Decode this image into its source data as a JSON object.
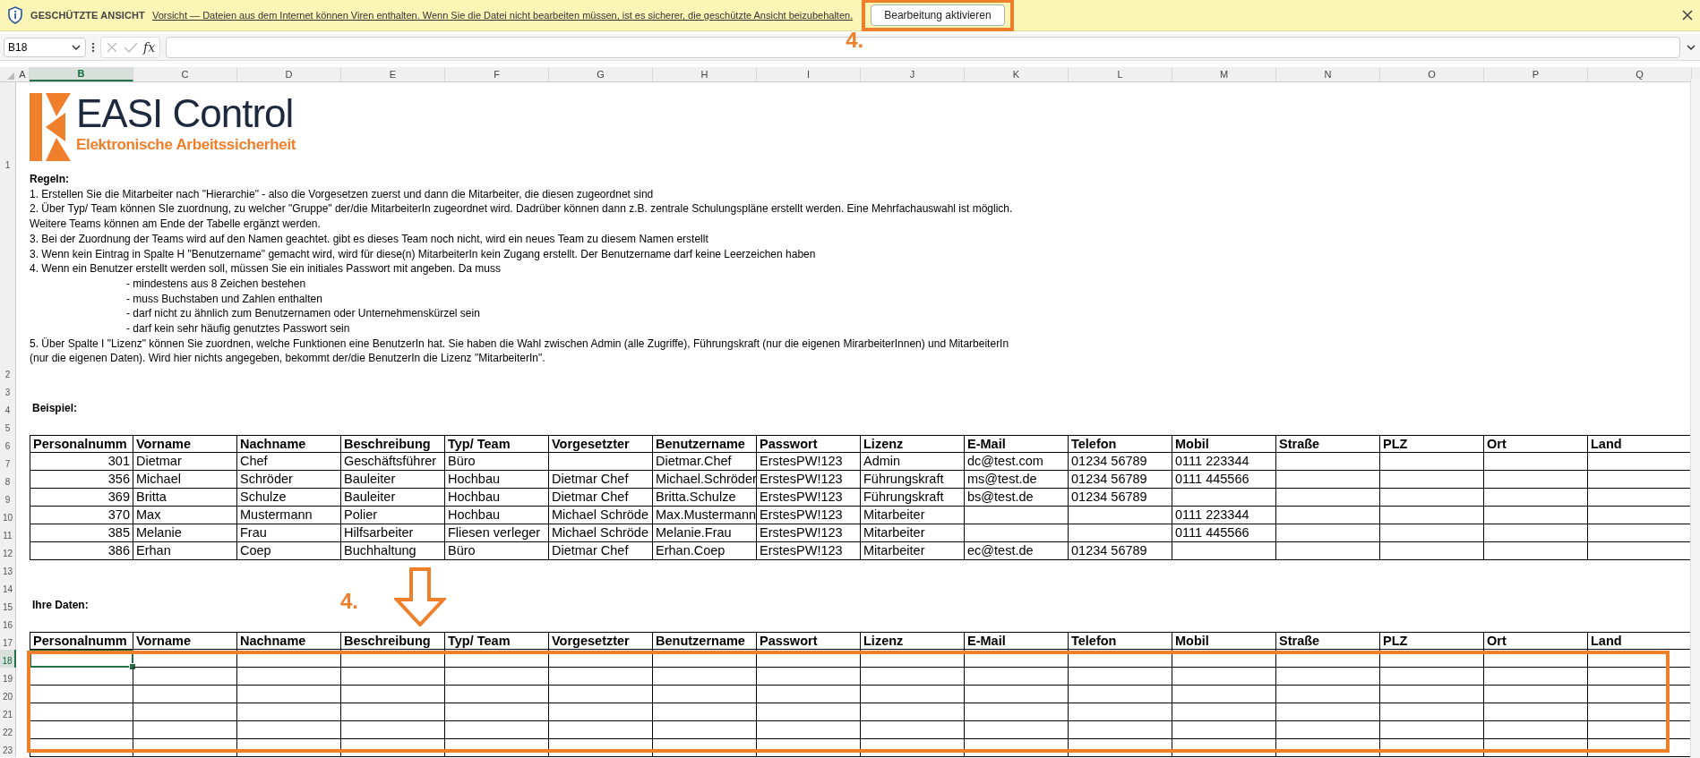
{
  "protected_view_bar": {
    "title": "GESCHÜTZTE ANSICHT",
    "message": "Vorsicht — Dateien aus dem Internet können Viren enthalten. Wenn Sie die Datei nicht bearbeiten müssen, ist es sicherer, die geschützte Ansicht beizubehalten.",
    "button": "Bearbeitung aktivieren"
  },
  "formula_bar": {
    "name_box": "B18",
    "function_label": "fx"
  },
  "columns": [
    {
      "label": "A",
      "selected": false
    },
    {
      "label": "B",
      "selected": true
    },
    {
      "label": "C",
      "selected": false
    },
    {
      "label": "D",
      "selected": false
    },
    {
      "label": "E",
      "selected": false
    },
    {
      "label": "F",
      "selected": false
    },
    {
      "label": "G",
      "selected": false
    },
    {
      "label": "H",
      "selected": false
    },
    {
      "label": "I",
      "selected": false
    },
    {
      "label": "J",
      "selected": false
    },
    {
      "label": "K",
      "selected": false
    },
    {
      "label": "L",
      "selected": false
    },
    {
      "label": "M",
      "selected": false
    },
    {
      "label": "N",
      "selected": false
    },
    {
      "label": "O",
      "selected": false
    },
    {
      "label": "P",
      "selected": false
    },
    {
      "label": "Q",
      "selected": false
    }
  ],
  "logo": {
    "name": "EASI Control",
    "tagline": "Elektronische Arbeitssicherheit"
  },
  "rules": {
    "title": "Regeln:",
    "lines": [
      {
        "kind": "item",
        "text": "1. Erstellen Sie die Mitarbeiter nach \"Hierarchie\" - also die Vorgesetzen zuerst und dann die Mitarbeiter, die diesen zugeordnet sind"
      },
      {
        "kind": "item",
        "text": "2. Über Typ/ Team können SIe zuordnung, zu welcher \"Gruppe\" der/die MitarbeiterIn zugeordnet wird. Dadrüber können dann z.B. zentrale Schulungspläne erstellt werden. Eine Mehrfachauswahl ist möglich."
      },
      {
        "kind": "item",
        "text": "Weitere Teams können am Ende der Tabelle ergänzt werden."
      },
      {
        "kind": "item",
        "text": "3. Bei der Zuordnung der Teams wird auf den Namen geachtet. gibt es dieses Team noch nicht, wird ein neues Team zu diesem Namen erstellt"
      },
      {
        "kind": "item",
        "text": "3. Wenn kein Eintrag in Spalte H \"Benutzername\" gemacht wird, wird für diese(n) MitarbeiterIn kein Zugang erstellt. Der Benutzername darf keine Leerzeichen haben"
      },
      {
        "kind": "item",
        "text": "4. Wenn ein Benutzer erstellt werden soll, müssen Sie ein initiales Passwort mit angeben. Da muss"
      },
      {
        "kind": "sub",
        "text": "- mindestens aus 8 Zeichen bestehen"
      },
      {
        "kind": "sub",
        "text": "- muss Buchstaben und Zahlen enthalten"
      },
      {
        "kind": "sub",
        "text": "-  darf nicht zu ähnlich zum Benutzernamen oder Unternehmenskürzel sein"
      },
      {
        "kind": "sub",
        "text": "- darf kein sehr häufig genutztes Passwort sein"
      },
      {
        "kind": "item",
        "text": "5. Über Spalte I \"Lizenz\" können Sie zuordnen, welche Funktionen eine BenutzerIn hat. Sie haben die Wahl zwischen Admin (alle Zugriffe), Führungskraft (nur die eigenen MirarbeiterInnen) und MitarbeiterIn"
      },
      {
        "kind": "item",
        "text": "(nur die eigenen Daten). Wird hier nichts angegeben, bekommt der/die BenutzerIn die Lizenz \"MitarbeiterIn\"."
      }
    ]
  },
  "rows": [
    {
      "number": "1",
      "selected": false,
      "kind": "logo"
    },
    {
      "number": "2",
      "selected": false,
      "kind": "rules"
    },
    {
      "number": "3",
      "selected": false,
      "kind": "blank"
    },
    {
      "number": "4",
      "selected": false,
      "kind": "label",
      "text": "Beispiel:"
    },
    {
      "number": "5",
      "selected": false,
      "kind": "blank"
    },
    {
      "number": "6",
      "selected": false,
      "kind": "header",
      "cells": [
        "Personalnumm",
        "Vorname",
        "Nachname",
        "Beschreibung",
        "Typ/ Team",
        "Vorgesetzter",
        "Benutzername",
        "Passwort",
        "Lizenz",
        "E-Mail",
        "Telefon",
        "Mobil",
        "Straße",
        "PLZ",
        "Ort",
        "Land"
      ]
    },
    {
      "number": "7",
      "selected": false,
      "kind": "data",
      "cells": {
        "B": "301",
        "C": "Dietmar",
        "D": "Chef",
        "E": "Geschäftsführer",
        "F": "Büro",
        "H": "Dietmar.Chef",
        "I": "ErstesPW!123",
        "J": "Admin",
        "K": "dc@test.com",
        "L": "01234 56789",
        "M": "0111 223344"
      }
    },
    {
      "number": "8",
      "selected": false,
      "kind": "data",
      "cells": {
        "B": "356",
        "C": "Michael",
        "D": "Schröder",
        "E": "Bauleiter",
        "F": "Hochbau",
        "G": "Dietmar Chef",
        "H": "Michael.Schröder",
        "I": "ErstesPW!123",
        "J": "Führungskraft",
        "K": "ms@test.de",
        "L": "01234 56789",
        "M": "0111 445566"
      }
    },
    {
      "number": "9",
      "selected": false,
      "kind": "data",
      "cells": {
        "B": "369",
        "C": "Britta",
        "D": "Schulze",
        "E": "Bauleiter",
        "F": "Hochbau",
        "G": "Dietmar Chef",
        "H": "Britta.Schulze",
        "I": "ErstesPW!123",
        "J": "Führungskraft",
        "K": "bs@test.de",
        "L": "01234 56789"
      }
    },
    {
      "number": "10",
      "selected": false,
      "kind": "data",
      "cells": {
        "B": "370",
        "C": "Max",
        "D": "Mustermann",
        "E": "Polier",
        "F": "Hochbau",
        "G": "Michael Schröde",
        "H": "Max.Mustermann",
        "I": "ErstesPW!123",
        "J": "Mitarbeiter",
        "M": "0111 223344"
      }
    },
    {
      "number": "11",
      "selected": false,
      "kind": "data",
      "cells": {
        "B": "385",
        "C": "Melanie",
        "D": "Frau",
        "E": "Hilfsarbeiter",
        "F": "Fliesen verleger",
        "G": "Michael Schröde",
        "H": "Melanie.Frau",
        "I": "ErstesPW!123",
        "J": "Mitarbeiter",
        "M": "0111 445566"
      }
    },
    {
      "number": "12",
      "selected": false,
      "kind": "data",
      "cells": {
        "B": "386",
        "C": "Erhan",
        "D": "Coep",
        "E": "Buchhaltung",
        "F": "Büro",
        "G": "Dietmar Chef",
        "H": "Erhan.Coep",
        "I": "ErstesPW!123",
        "J": "Mitarbeiter",
        "K": "ec@test.de",
        "L": "01234 56789"
      }
    },
    {
      "number": "13",
      "selected": false,
      "kind": "blank"
    },
    {
      "number": "14",
      "selected": false,
      "kind": "blank"
    },
    {
      "number": "15",
      "selected": false,
      "kind": "label",
      "text": "Ihre Daten:"
    },
    {
      "number": "16",
      "selected": false,
      "kind": "blank"
    },
    {
      "number": "17",
      "selected": false,
      "kind": "header",
      "cells": [
        "Personalnumm",
        "Vorname",
        "Nachname",
        "Beschreibung",
        "Typ/ Team",
        "Vorgesetzter",
        "Benutzername",
        "Passwort",
        "Lizenz",
        "E-Mail",
        "Telefon",
        "Mobil",
        "Straße",
        "PLZ",
        "Ort",
        "Land"
      ]
    },
    {
      "number": "18",
      "selected": true,
      "kind": "entry"
    },
    {
      "number": "19",
      "selected": false,
      "kind": "entry"
    },
    {
      "number": "20",
      "selected": false,
      "kind": "entry"
    },
    {
      "number": "21",
      "selected": false,
      "kind": "entry"
    },
    {
      "number": "22",
      "selected": false,
      "kind": "entry"
    },
    {
      "number": "23",
      "selected": false,
      "kind": "entry"
    }
  ],
  "button_annotation": {
    "text": "4."
  },
  "table_annotation": {
    "text": "4."
  }
}
